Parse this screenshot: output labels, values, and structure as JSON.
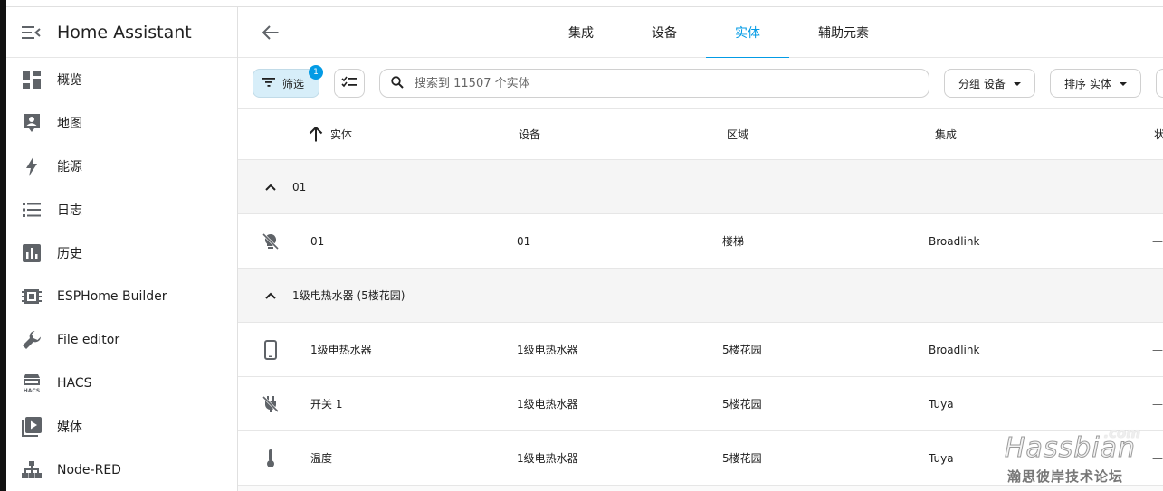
{
  "app": {
    "title": "Home Assistant"
  },
  "sidebar": {
    "items": [
      {
        "label": "概览",
        "icon": "dashboard-icon"
      },
      {
        "label": "地图",
        "icon": "map-account-icon"
      },
      {
        "label": "能源",
        "icon": "lightning-icon"
      },
      {
        "label": "日志",
        "icon": "list-icon"
      },
      {
        "label": "历史",
        "icon": "chart-box-icon"
      },
      {
        "label": "ESPHome Builder",
        "icon": "chip-icon"
      },
      {
        "label": "File editor",
        "icon": "wrench-icon"
      },
      {
        "label": "HACS",
        "icon": "hacs-icon"
      },
      {
        "label": "媒体",
        "icon": "play-box-icon"
      },
      {
        "label": "Node-RED",
        "icon": "sitemap-icon"
      }
    ]
  },
  "header": {
    "tabs": [
      {
        "label": "集成",
        "active": false
      },
      {
        "label": "设备",
        "active": false
      },
      {
        "label": "实体",
        "active": true
      },
      {
        "label": "辅助元素",
        "active": false
      }
    ]
  },
  "toolbar": {
    "filter_label": "筛选",
    "filter_count": "1",
    "search_placeholder": "搜索到 11507 个实体",
    "group_label": "分组 设备",
    "sort_label": "排序 实体"
  },
  "table": {
    "columns": {
      "name": "实体",
      "device": "设备",
      "area": "区域",
      "integration": "集成",
      "status": "状"
    },
    "groups": [
      {
        "label": "01",
        "rows": [
          {
            "icon": "lightbulb-off-icon",
            "name": "01",
            "device": "01",
            "area": "楼梯",
            "integration": "Broadlink",
            "status": "—"
          }
        ]
      },
      {
        "label": "1级电热水器 (5楼花园)",
        "rows": [
          {
            "icon": "cellphone-icon",
            "name": "1级电热水器",
            "device": "1级电热水器",
            "area": "5楼花园",
            "integration": "Broadlink",
            "status": "—"
          },
          {
            "icon": "power-plug-off-icon",
            "name": "开关 1",
            "device": "1级电热水器",
            "area": "5楼花园",
            "integration": "Tuya",
            "status": "—"
          },
          {
            "icon": "thermometer-icon",
            "name": "温度",
            "device": "1级电热水器",
            "area": "5楼花园",
            "integration": "Tuya",
            "status": "—"
          }
        ]
      }
    ]
  },
  "watermark": {
    "com": ".com",
    "name": "Hassbian",
    "sub": "瀚思彼岸技术论坛"
  },
  "colors": {
    "accent": "#039be5",
    "filter_bg": "#d7eef9",
    "icon": "#5f6368"
  }
}
